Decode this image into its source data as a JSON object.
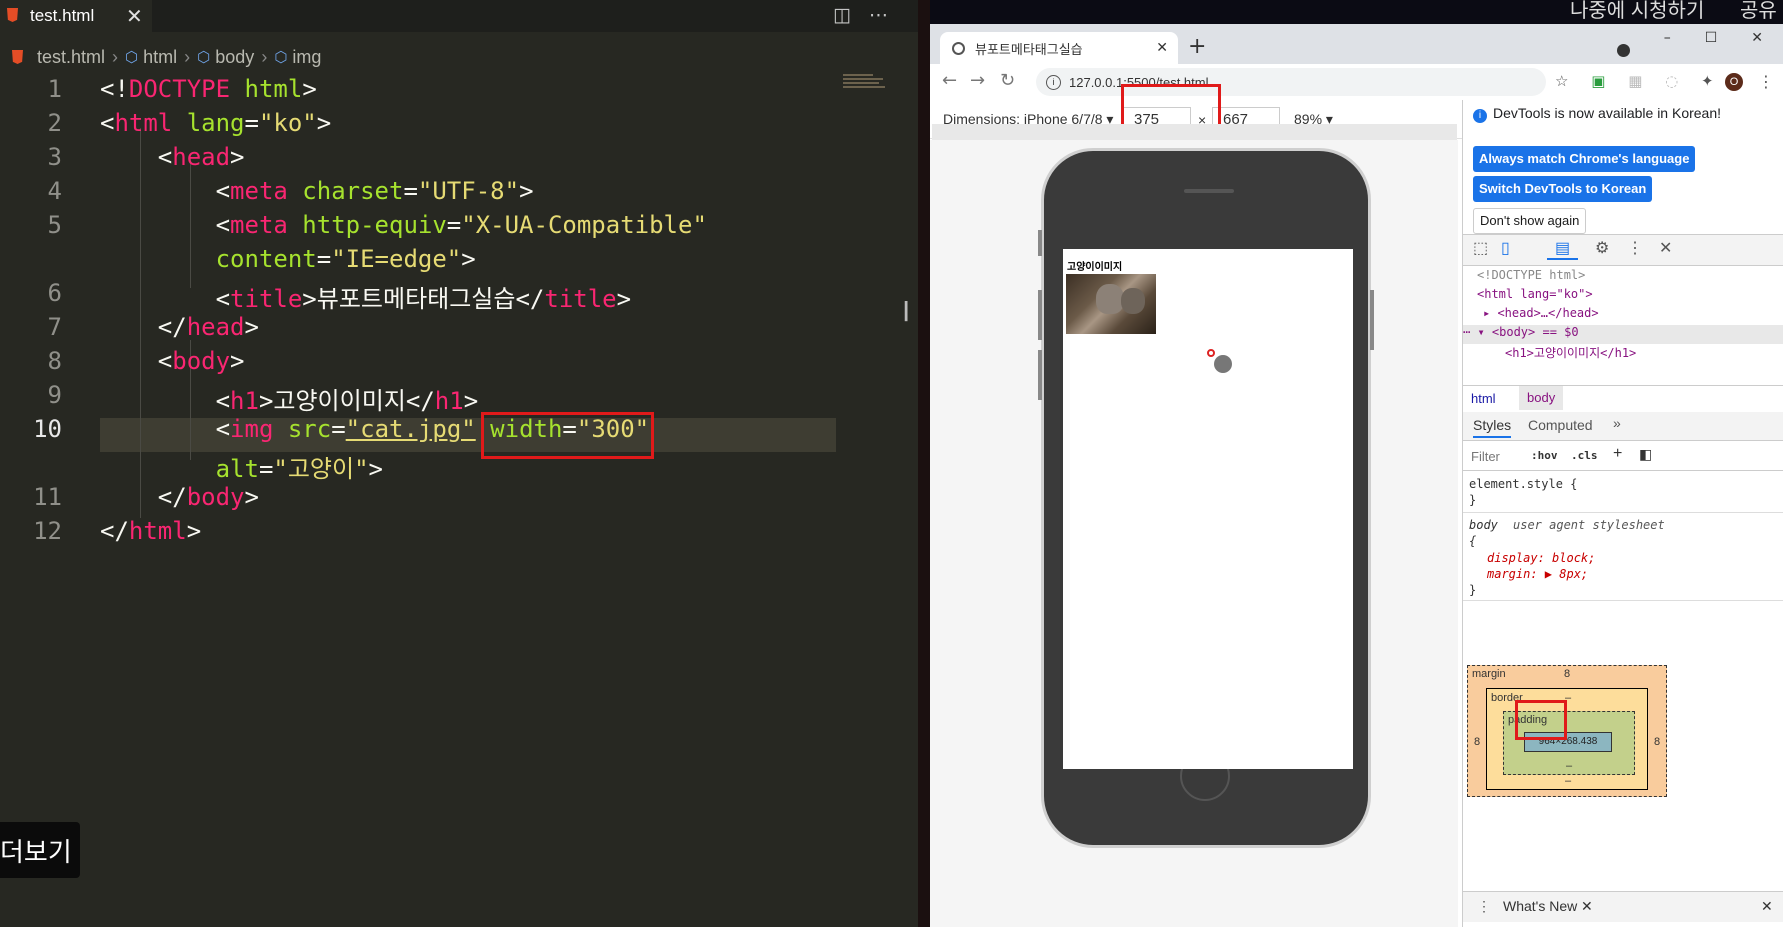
{
  "editor": {
    "tab_title": "test.html",
    "tab_close": "✕",
    "breadcrumbs": [
      "test.html",
      "html",
      "body",
      "img"
    ],
    "line_numbers": [
      "1",
      "2",
      "3",
      "4",
      "5",
      "",
      "6",
      "7",
      "8",
      "9",
      "10",
      "",
      "11",
      "12"
    ],
    "caption": "더보기"
  },
  "browser": {
    "top_text_1": "나중에 시청하기",
    "top_text_2": "공유",
    "tab_title": "뷰포트메타태그실습",
    "url": "127.0.0.1:5500/test.html",
    "avatar": "O",
    "device_label": "Dimensions: iPhone 6/7/8",
    "width_value": "375",
    "height_value": "667",
    "times": "×",
    "zoom": "89%",
    "page_heading": "고양이이미지"
  },
  "devtools": {
    "notice": "DevTools is now available in Korean!",
    "btn_match": "Always match Chrome's language",
    "btn_switch": "Switch DevTools to Korean",
    "btn_dont_show": "Don't show again",
    "dom_lines": [
      "<!DOCTYPE html>",
      "<html lang=\"ko\">",
      "<head>…</head>",
      "<body> == $0",
      "<h1>고양이이미지</h1>"
    ],
    "crumb_html": "html",
    "crumb_body": "body",
    "tab_styles": "Styles",
    "tab_computed": "Computed",
    "tab_more": "»",
    "filter": "Filter",
    "hov": ":hov",
    "cls": ".cls",
    "element_style": "element.style {",
    "close_brace": "}",
    "body_selector": "body",
    "ua_stylesheet": "user agent stylesheet",
    "open_brace": "{",
    "decl_display": "display: block;",
    "decl_margin": "margin: ▶ 8px;",
    "bm_margin": "margin",
    "bm_margin_val": "8",
    "bm_border": "border",
    "bm_dash": "–",
    "bm_padding": "padding",
    "bm_content": "964×268.438",
    "bm_side": "8",
    "whats_new": "What's New",
    "close": "✕"
  }
}
